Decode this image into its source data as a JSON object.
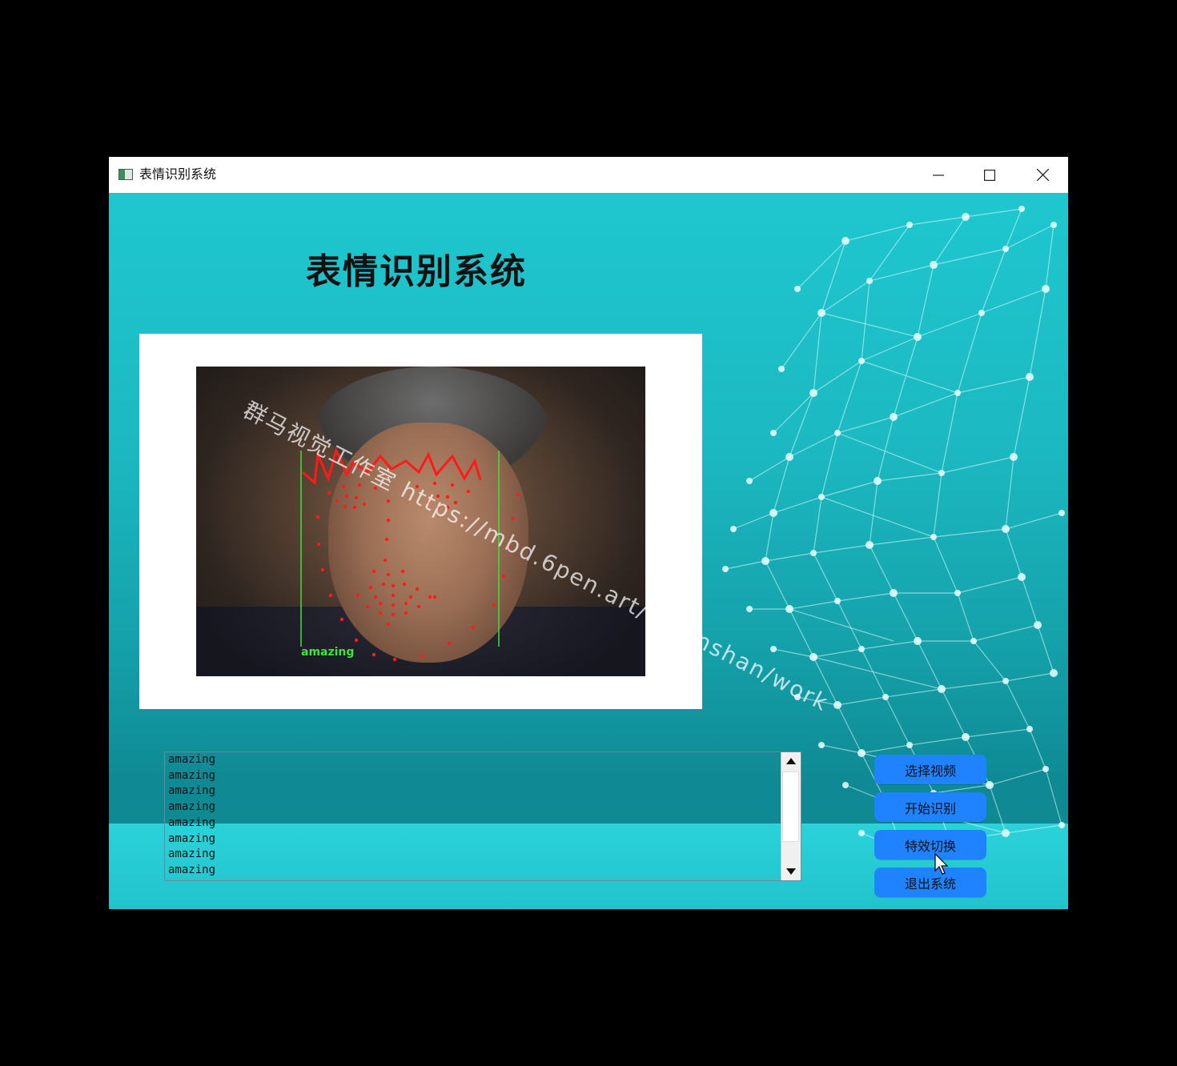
{
  "window": {
    "title": "表情识别系统"
  },
  "main": {
    "heading": "表情识别系统",
    "detection_label": "amazing",
    "watermark": "群马视觉工作室  https://mbd.6pen.art/o/qunshan/work"
  },
  "log": {
    "lines": [
      "amazing",
      "amazing",
      "amazing",
      "amazing",
      "amazing",
      "amazing",
      "amazing",
      "amazing"
    ]
  },
  "buttons": {
    "select_video": "选择视频",
    "start_recognition": "开始识别",
    "switch_effect": "特效切换",
    "exit_system": "退出系统"
  },
  "colors": {
    "accent_button": "#1f82ff",
    "background_teal": "#1cb9c2",
    "landmark_red": "#ff1a1a",
    "bbox_green": "#3fe23f"
  }
}
